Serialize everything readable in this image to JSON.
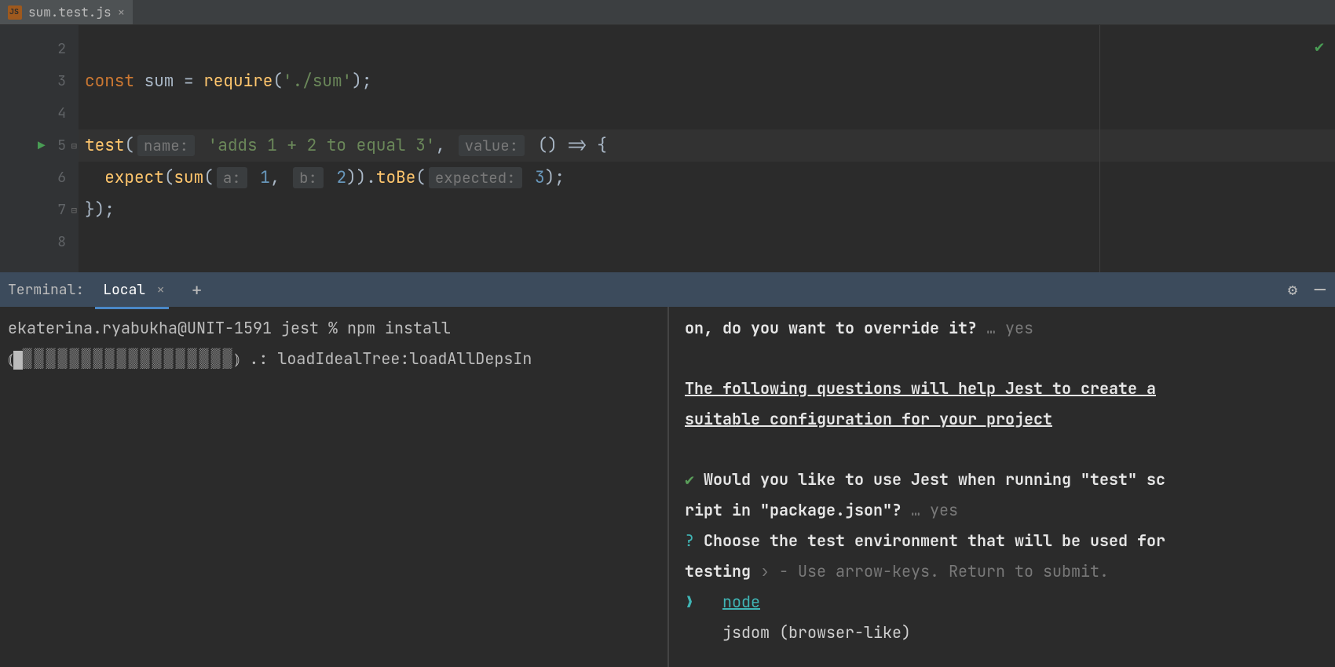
{
  "tab": {
    "filename": "sum.test.js",
    "close": "×"
  },
  "gutter": {
    "lines": [
      "2",
      "3",
      "4",
      "5",
      "6",
      "7",
      "8"
    ]
  },
  "code": {
    "l3": {
      "kw": "const",
      "id": " sum ",
      "op": "= ",
      "fn": "require",
      "p1": "(",
      "str": "'./sum'",
      "p2": ");"
    },
    "l5": {
      "fn": "test",
      "p1": "(",
      "h1": "name:",
      "str": " 'adds 1 + 2 to equal 3'",
      "c": ", ",
      "h2": "value:",
      "arrow": " () => {"
    },
    "l6": {
      "indent": "  ",
      "fn1": "expect",
      "p1": "(",
      "fn2": "sum",
      "p2": "(",
      "h1": "a:",
      "n1": " 1",
      "c1": ", ",
      "h2": "b:",
      "n2": " 2",
      "p3": ")).",
      "fn3": "toBe",
      "p4": "(",
      "h3": "expected:",
      "n3": " 3",
      "p5": ");"
    },
    "l7": {
      "txt": "});"
    }
  },
  "terminal": {
    "title": "Terminal:",
    "tab": "Local",
    "tab_close": "×",
    "add": "+",
    "gear": "⚙",
    "minimize": "—"
  },
  "left_pane": {
    "line1": "ekaterina.ryabukha@UNIT-1591 jest % npm install",
    "lparen": "⦅",
    "progress": "▒▒▒▒▒▒▒▒▒▒▒▒▒▒▒▒▒▒",
    "rparen": "⦆",
    "status": " .: loadIdealTree:loadAllDepsIn"
  },
  "right_pane": {
    "l1a": "on, do you want to override it?",
    "l1b": " … yes",
    "l2a": "The following questions will help Jest to create a",
    "l2b": "suitable configuration for your project",
    "check": "✔",
    "q1a": " Would you like to use Jest when running \"test\" sc",
    "q1b": "ript in \"package.json\"?",
    "q1ans": " … yes",
    "qmark": "?",
    "q2a": " Choose the test environment that will be used for",
    "q2b": " testing",
    "q2hint": " › - Use arrow-keys. Return to submit.",
    "arrow": "❯",
    "opt1": "node",
    "opt2": "jsdom (browser-like)"
  }
}
